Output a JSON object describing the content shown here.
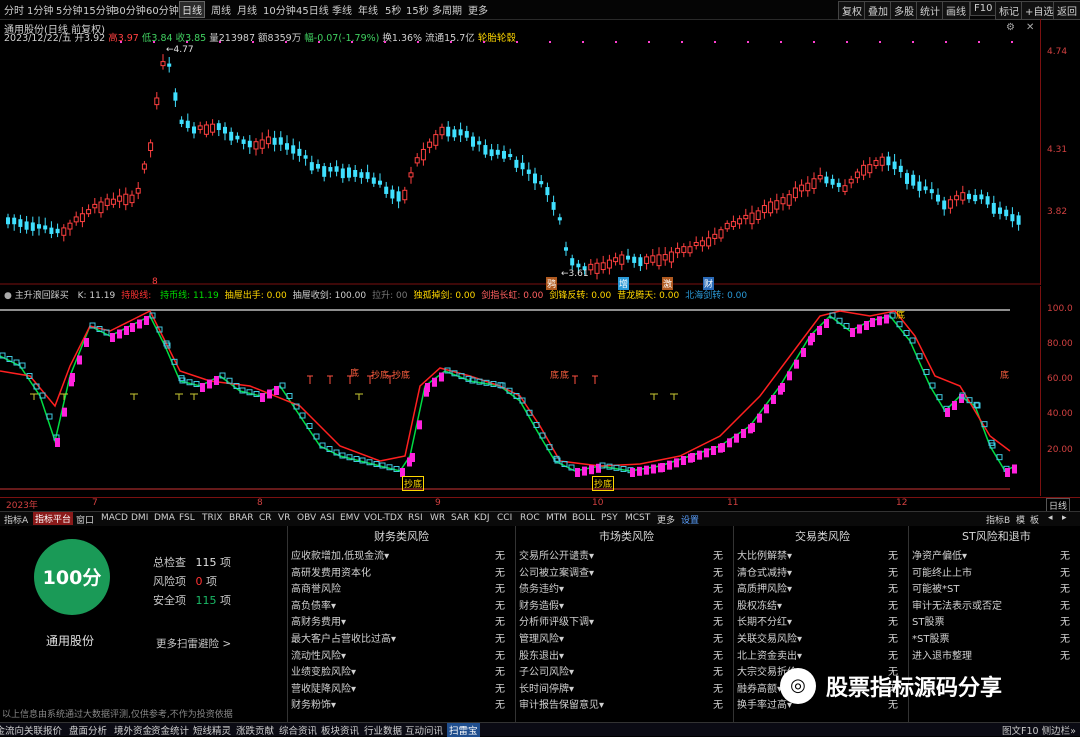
{
  "toolbar": {
    "tabs": [
      "分时",
      "1分钟",
      "5分钟",
      "15分钟",
      "30分钟",
      "60分钟",
      "日线",
      "周线",
      "月线",
      "10分钟",
      "45日线",
      "季线",
      "年线",
      "5秒",
      "15秒",
      "多周期",
      "更多"
    ],
    "active": "日线",
    "right_tools": [
      "复权",
      "叠加",
      "多股",
      "统计",
      "画线",
      "F10",
      "标记",
      "+自选",
      "返回"
    ]
  },
  "kline": {
    "title": "通用股份(日线 前复权)",
    "info": {
      "date": "2023/12/22/五",
      "open": "开3.92",
      "high": "高3.97",
      "low": "低3.84",
      "close": "收3.85",
      "volume": "量213987",
      "amount": "额8359万",
      "change": "幅-0.07(-1.79%)",
      "turnover": "换1.36%",
      "float": "流通15.7亿",
      "tag": "轮胎轮毂"
    },
    "high_label": "4.77",
    "low_label": "3.61",
    "y_ticks": [
      "4.74",
      "4.31",
      "3.82"
    ],
    "markers": [
      "8",
      "鸦",
      "增",
      "激",
      "财"
    ]
  },
  "indicator": {
    "name": "主升浪回踩买",
    "params": [
      {
        "text": "K: 11.19",
        "color": "#d0d0d0"
      },
      {
        "text": "持股线: ",
        "color": "#ff3333"
      },
      {
        "text": "持币线: 11.19",
        "color": "#00dd00"
      },
      {
        "text": "抽屉出手: 0.00",
        "color": "#ffd700"
      },
      {
        "text": "抽屉收剑: 100.00",
        "color": "#d0d0d0"
      },
      {
        "text": "拉升: 00",
        "color": "#777777"
      },
      {
        "text": "独孤掉剑: 0.00",
        "color": "#ffd700"
      },
      {
        "text": "剑指长虹: 0.00",
        "color": "#ff6060"
      },
      {
        "text": "剑锋反转: 0.00",
        "color": "#ffd700"
      },
      {
        "text": "昔龙腾天: 0.00",
        "color": "#ffd700"
      },
      {
        "text": "北海剑转: 0.00",
        "color": "#2a9ad8"
      }
    ],
    "y_ticks": [
      "100.0",
      "80.00",
      "60.00",
      "40.00",
      "20.00"
    ],
    "labels": [
      "抄底",
      "底",
      "抄底",
      "底",
      "底",
      "底",
      "抄底",
      "抄底",
      "底"
    ]
  },
  "date_axis": {
    "labels": [
      "2023年",
      "7",
      "8",
      "9",
      "10",
      "11",
      "12"
    ],
    "right": "日线"
  },
  "indicator_tabs": [
    "指标A",
    "指标平台",
    "窗口",
    "MACD",
    "DMI",
    "DMA",
    "FSL",
    "TRIX",
    "BRAR",
    "CR",
    "VR",
    "OBV",
    "ASI",
    "EMV",
    "VOL-TDX",
    "RSI",
    "WR",
    "SAR",
    "KDJ",
    "CCI",
    "ROC",
    "MTM",
    "BOLL",
    "PSY",
    "MCST",
    "更多",
    "设置"
  ],
  "indicator_tabs_right": [
    "指标B",
    "模",
    "板"
  ],
  "risk": {
    "score": "100分",
    "score_color": "#1a9a57",
    "stock_name": "通用股份",
    "summary": [
      {
        "label": "总检查",
        "value": "115",
        "unit": "项",
        "color": "#d0d0d0"
      },
      {
        "label": "风险项",
        "value": "0",
        "unit": "项",
        "color": "#ff3333"
      },
      {
        "label": "安全项",
        "value": "115",
        "unit": "项",
        "color": "#1aba66"
      }
    ],
    "more": "更多扫雷避险 >",
    "disclaimer": "以上信息由系统通过大数据评测,仅供参考,不作为投资依据",
    "categories": [
      {
        "title": "财务类风险",
        "items": [
          "应收款增加,低现金流▾",
          "高研发费用资本化",
          "高商誉风险",
          "高负债率▾",
          "高财务费用▾",
          "最大客户占营收比过高▾",
          "流动性风险▾",
          "业绩变脸风险▾",
          "营收陡降风险▾",
          "财务粉饰▾"
        ],
        "values": [
          "无",
          "无",
          "无",
          "无",
          "无",
          "无",
          "无",
          "无",
          "无",
          "无"
        ]
      },
      {
        "title": "市场类风险",
        "items": [
          "交易所公开谴责▾",
          "公司被立案调查▾",
          "债务违约▾",
          "财务造假▾",
          "分析师评级下调▾",
          "管理风险▾",
          "股东退出▾",
          "子公司风险▾",
          "长时间停牌▾",
          "审计报告保留意见▾"
        ],
        "values": [
          "无",
          "无",
          "无",
          "无",
          "无",
          "无",
          "无",
          "无",
          "无",
          "无"
        ]
      },
      {
        "title": "交易类风险",
        "items": [
          "大比例解禁▾",
          "清仓式减持▾",
          "高质押风险▾",
          "股权冻结▾",
          "长期不分红▾",
          "关联交易风险▾",
          "北上资金卖出▾",
          "大宗交易折价▾",
          "融券高额▾",
          "换手率过高▾"
        ],
        "values": [
          "无",
          "无",
          "无",
          "无",
          "无",
          "无",
          "无",
          "无",
          "无",
          "无"
        ]
      },
      {
        "title": "ST风险和退市",
        "items": [
          "净资产偏低▾",
          "可能终止上市",
          "可能被*ST",
          "审计无法表示或否定",
          "ST股票",
          "*ST股票",
          "进入退市整理"
        ],
        "values": [
          "无",
          "无",
          "无",
          "无",
          "无",
          "无",
          "无"
        ]
      }
    ]
  },
  "watermark": "股票指标源码分享",
  "statusbar": {
    "tabs": [
      "资金流向",
      "关联报价",
      "盘面分析",
      "境外资金",
      "资金统计",
      "短线精灵",
      "涨跌贡献",
      "综合资讯",
      "板块资讯",
      "行业数据",
      "互动问讯",
      "扫雷宝"
    ],
    "active": "扫雷宝",
    "right": "图文F10 侧边栏»"
  }
}
